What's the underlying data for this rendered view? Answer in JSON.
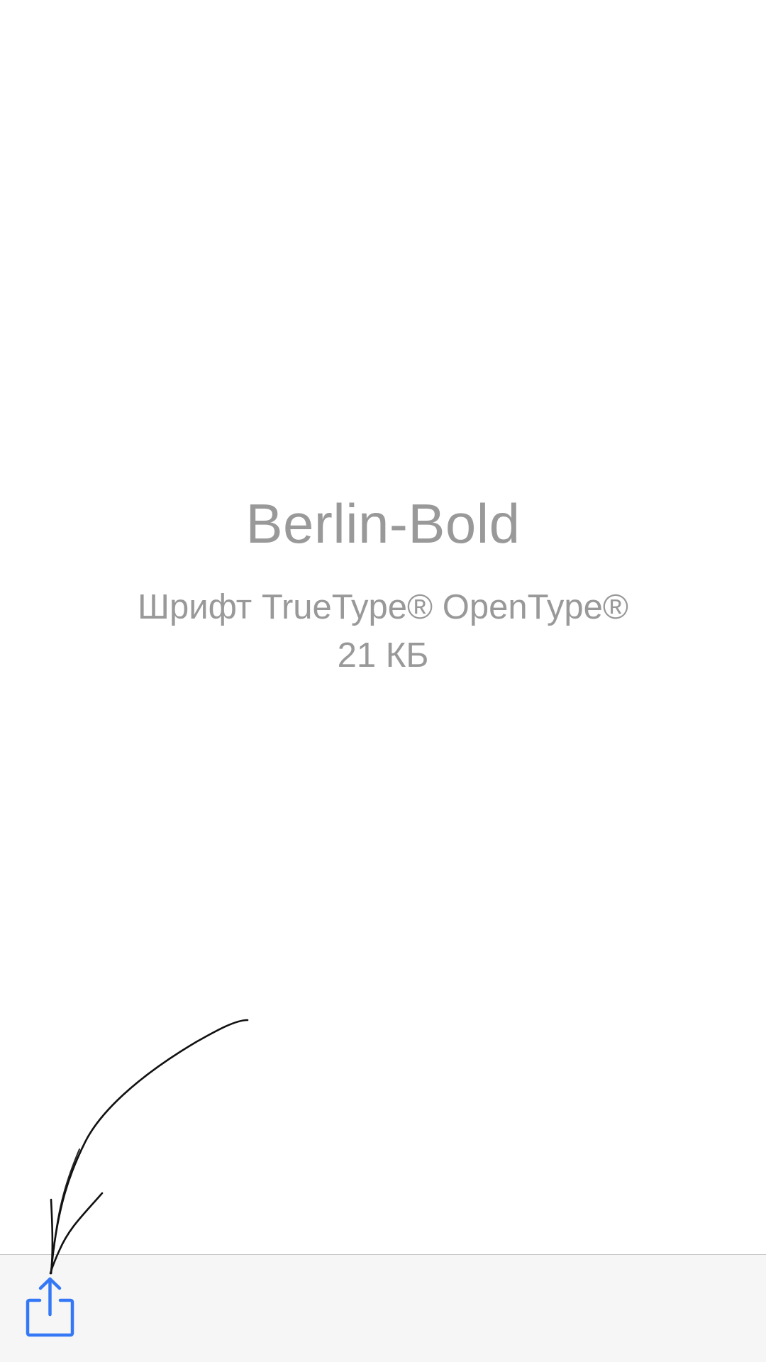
{
  "file": {
    "name": "Berlin-Bold",
    "type": "Шрифт TrueType® OpenType®",
    "size": "21 КБ"
  },
  "toolbar": {
    "share_icon": "share-icon"
  },
  "colors": {
    "accent": "#3478f6",
    "text_secondary": "#999999",
    "toolbar_bg": "#f6f6f6",
    "annotation": "#111111"
  }
}
